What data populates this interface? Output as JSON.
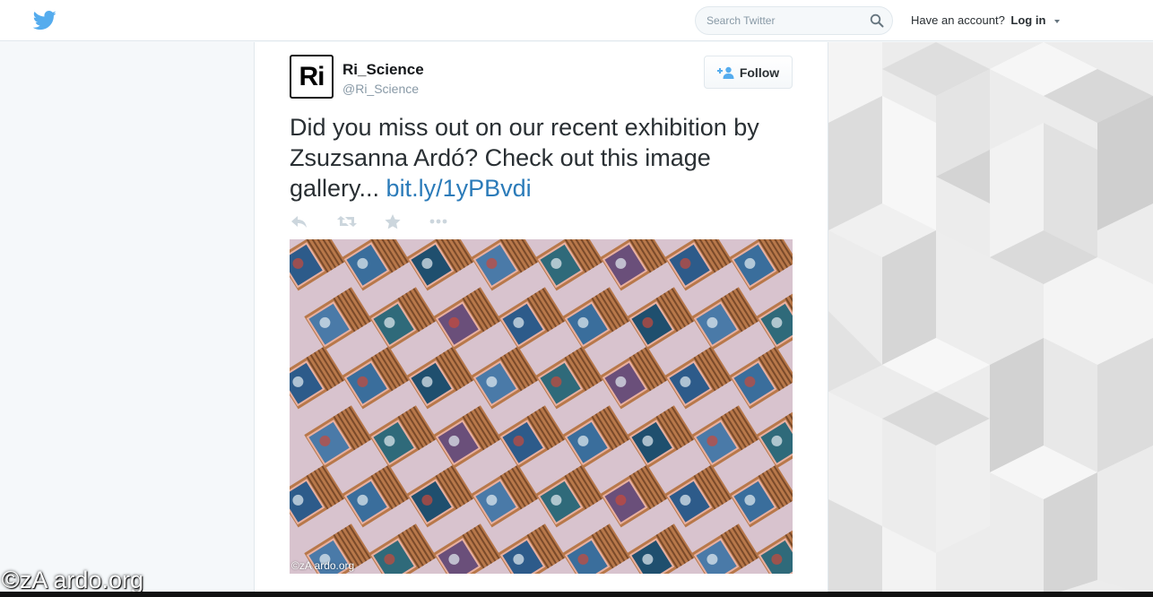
{
  "header": {
    "search_placeholder": "Search Twitter",
    "account_prompt": "Have an account?",
    "login_label": "Log in"
  },
  "tweet": {
    "author_name": "Ri_Science",
    "author_handle": "@Ri_Science",
    "avatar_text": "Ri",
    "follow_label": "Follow",
    "text": "Did you miss out on our recent exhibition by Zsuzsanna Ardó? Check out this image gallery... ",
    "link_text": "bit.ly/1yPBvdi",
    "media_credit": "©zA ardo.org"
  },
  "watermark": "©zA ardo.org",
  "colors": {
    "brand_blue": "#55acee",
    "link_blue": "#2b7bb9",
    "muted_icon": "#ccd6dd"
  },
  "icons": [
    "twitter-bird-icon",
    "search-icon",
    "caret-down-icon",
    "follow-person-icon",
    "reply-icon",
    "retweet-icon",
    "favorite-star-icon",
    "more-dots-icon"
  ]
}
